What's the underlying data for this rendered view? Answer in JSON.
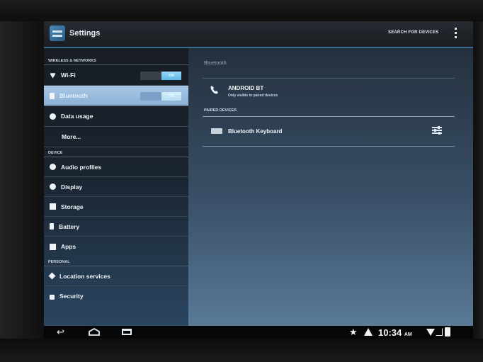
{
  "actionbar": {
    "title": "Settings",
    "search_action": "SEARCH FOR DEVICES",
    "app_icon": "settings-app-icon",
    "overflow_icon": "overflow-menu-icon"
  },
  "sidebar": {
    "sections": {
      "wireless": "WIRELESS & NETWORKS",
      "device": "DEVICE",
      "personal": "PERSONAL"
    },
    "items": [
      {
        "label": "Wi-Fi",
        "icon": "wifi-icon",
        "toggle": "ON"
      },
      {
        "label": "Bluetooth",
        "icon": "bluetooth-icon",
        "toggle": "ON",
        "selected": true
      },
      {
        "label": "Data usage",
        "icon": "data-usage-icon"
      },
      {
        "label": "More..."
      },
      {
        "label": "Audio profiles",
        "icon": "audio-icon"
      },
      {
        "label": "Display",
        "icon": "display-icon"
      },
      {
        "label": "Storage",
        "icon": "storage-icon"
      },
      {
        "label": "Battery",
        "icon": "battery-icon"
      },
      {
        "label": "Apps",
        "icon": "apps-icon"
      },
      {
        "label": "Location services",
        "icon": "location-icon"
      },
      {
        "label": "Security",
        "icon": "lock-icon"
      }
    ]
  },
  "detail": {
    "title": "Bluetooth",
    "device": {
      "name": "ANDROID BT",
      "subtitle": "Only visible to paired devices",
      "icon": "phone-icon"
    },
    "paired_header": "PAIRED DEVICES",
    "paired": [
      {
        "name": "Bluetooth Keyboard",
        "icon": "keyboard-icon",
        "action_icon": "settings-sliders-icon"
      }
    ]
  },
  "navbar": {
    "icons": [
      "back-icon",
      "home-icon",
      "recents-icon"
    ]
  },
  "status": {
    "time": "10:34",
    "ampm": "AM",
    "icons": [
      "star-icon",
      "alert-icon",
      "wifi-status-icon",
      "signal-icon",
      "battery-status-icon"
    ]
  },
  "colors": {
    "accent": "#3a6a8a",
    "selected_item": "#9abce0",
    "toggle_on": "#5ab8e8"
  }
}
